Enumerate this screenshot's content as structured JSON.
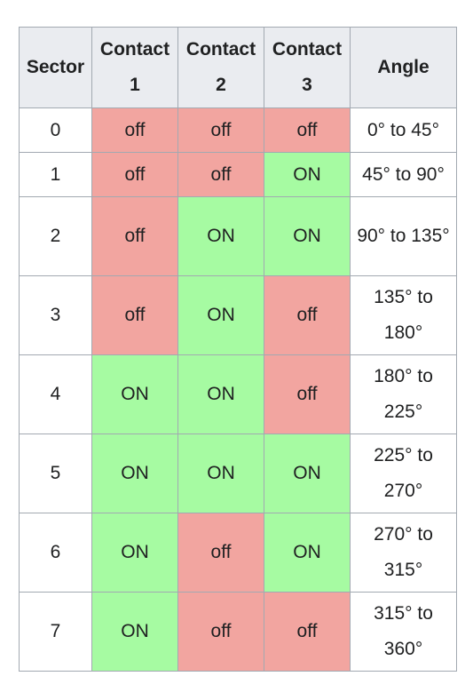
{
  "headers": {
    "sector": "Sector",
    "contact1": "Contact 1",
    "contact2": "Contact 2",
    "contact3": "Contact 3",
    "angle": "Angle"
  },
  "rows": [
    {
      "sector": "0",
      "c1": "off",
      "c2": "off",
      "c3": "off",
      "angle": "0° to 45°"
    },
    {
      "sector": "1",
      "c1": "off",
      "c2": "off",
      "c3": "ON",
      "angle": "45° to 90°"
    },
    {
      "sector": "2",
      "c1": "off",
      "c2": "ON",
      "c3": "ON",
      "angle": "90° to 135°"
    },
    {
      "sector": "3",
      "c1": "off",
      "c2": "ON",
      "c3": "off",
      "angle": "135° to 180°"
    },
    {
      "sector": "4",
      "c1": "ON",
      "c2": "ON",
      "c3": "off",
      "angle": "180° to 225°"
    },
    {
      "sector": "5",
      "c1": "ON",
      "c2": "ON",
      "c3": "ON",
      "angle": "225° to 270°"
    },
    {
      "sector": "6",
      "c1": "ON",
      "c2": "off",
      "c3": "ON",
      "angle": "270° to 315°"
    },
    {
      "sector": "7",
      "c1": "ON",
      "c2": "off",
      "c3": "off",
      "angle": "315° to 360°"
    }
  ],
  "colors": {
    "off": "#f2a5a0",
    "on": "#a6fba2",
    "header": "#eaecf0",
    "border": "#a2a9b1"
  }
}
